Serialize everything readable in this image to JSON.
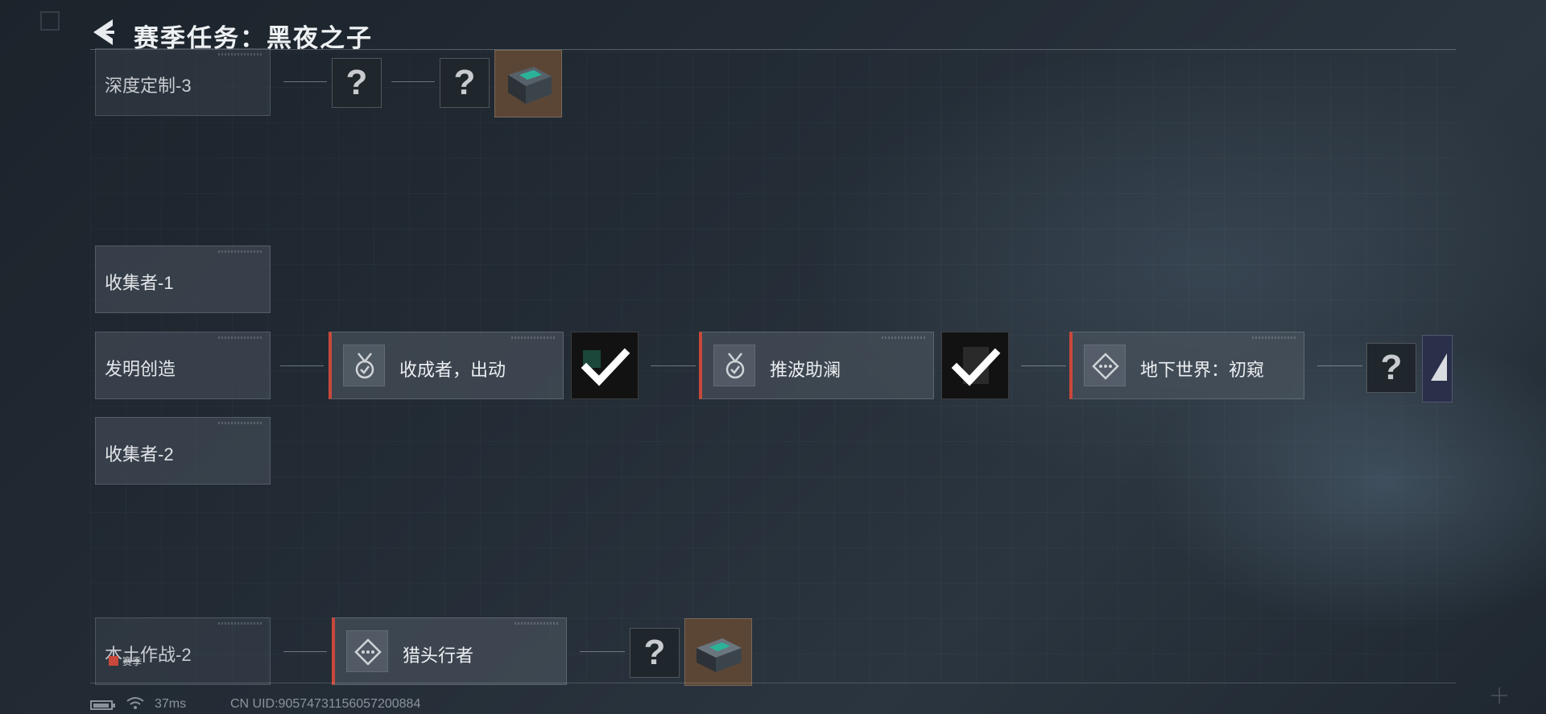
{
  "header": {
    "title": "赛季任务：黑夜之子",
    "back_icon": "back-arrow-icon"
  },
  "categories": [
    {
      "label": "深度定制-3"
    },
    {
      "label": "收集者-1"
    },
    {
      "label": "发明创造"
    },
    {
      "label": "收集者-2"
    },
    {
      "label": "本土作战-2"
    }
  ],
  "row_top": {
    "unknown_1": "?",
    "unknown_2": "?"
  },
  "row_main": {
    "missions": [
      {
        "label": "收成者，出动",
        "icon": "medal-icon",
        "reward_status": "completed"
      },
      {
        "label": "推波助澜",
        "icon": "medal-icon",
        "reward_status": "completed"
      },
      {
        "label": "地下世界：初窥",
        "icon": "diamond-dots-icon"
      }
    ],
    "unknown": "?"
  },
  "row_bottom": {
    "mission": {
      "label": "猎头行者",
      "icon": "diamond-dots-icon"
    },
    "unknown": "?",
    "season_tag": "赛季"
  },
  "status_bar": {
    "ping": "37ms",
    "uid": "CN UID:90574731156057200884"
  },
  "colors": {
    "accent_red": "#c9483b",
    "background": "#232c35",
    "crate": "#5b4636"
  }
}
